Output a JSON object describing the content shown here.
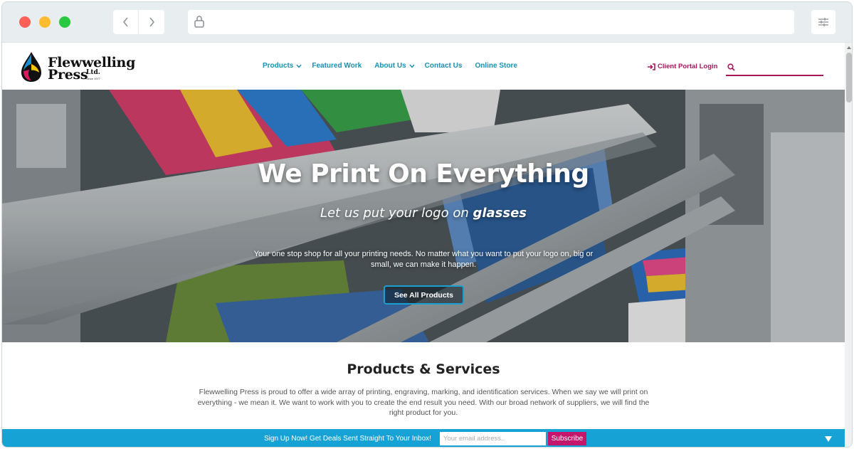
{
  "header": {
    "logo": {
      "line1": "Flewwelling",
      "line2": "Press",
      "ltd": "Ltd.",
      "since": "Since 1977"
    },
    "nav": [
      {
        "label": "Products",
        "has_dropdown": true
      },
      {
        "label": "Featured Work",
        "has_dropdown": false
      },
      {
        "label": "About Us",
        "has_dropdown": true
      },
      {
        "label": "Contact Us",
        "has_dropdown": false
      },
      {
        "label": "Online Store",
        "has_dropdown": false
      }
    ],
    "client_login": "Client Portal Login",
    "search_placeholder": ""
  },
  "hero": {
    "title": "We Print On Everything",
    "subtitle_prefix": "Let us put your logo on ",
    "subtitle_emphasis": "glasses",
    "body": "Your one stop shop for all your printing needs.  No matter what you want to put your logo on, big or small, we can make it happen.",
    "button": "See All Products"
  },
  "products": {
    "title": "Products & Services",
    "text": "Flewwelling Press is proud to offer a wide array of printing, engraving, marking, and identification services. When we say we will print on everything - we mean it. We want to work with you to create the end result you need. With our broad network of suppliers, we will find the right product for you."
  },
  "newsletter": {
    "text": "Sign Up Now! Get Deals Sent Straight To Your Inbox!",
    "placeholder": "Your email address..",
    "button": "Subscribe"
  },
  "colors": {
    "nav_link": "#1a8fb3",
    "accent_magenta": "#a8175c",
    "newsletter_bg": "#17a2d6",
    "subscribe_btn": "#c4176c"
  }
}
